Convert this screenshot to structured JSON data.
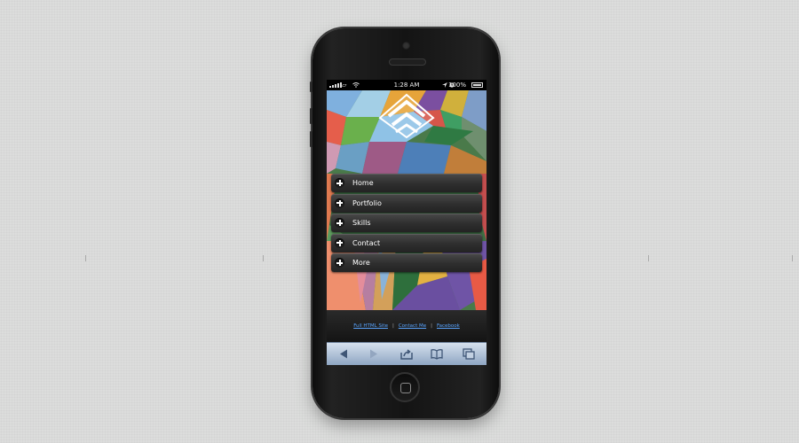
{
  "status_bar": {
    "time": "1:28 AM",
    "battery": "100%"
  },
  "menu": {
    "items": [
      {
        "label": "Home"
      },
      {
        "label": "Portfolio"
      },
      {
        "label": "Skills"
      },
      {
        "label": "Contact"
      },
      {
        "label": "More"
      }
    ]
  },
  "footer": {
    "links": [
      "Full HTML Site",
      "Contact Me",
      "Facebook"
    ],
    "separator": "|"
  },
  "browser_toolbar": {
    "buttons": [
      "back-icon",
      "forward-icon",
      "share-icon",
      "bookmarks-icon",
      "tabs-icon"
    ]
  },
  "colors": {
    "menu_text": "#ffffff",
    "footer_link": "#5aa5ff",
    "toolbar": "#a9bbd2"
  }
}
